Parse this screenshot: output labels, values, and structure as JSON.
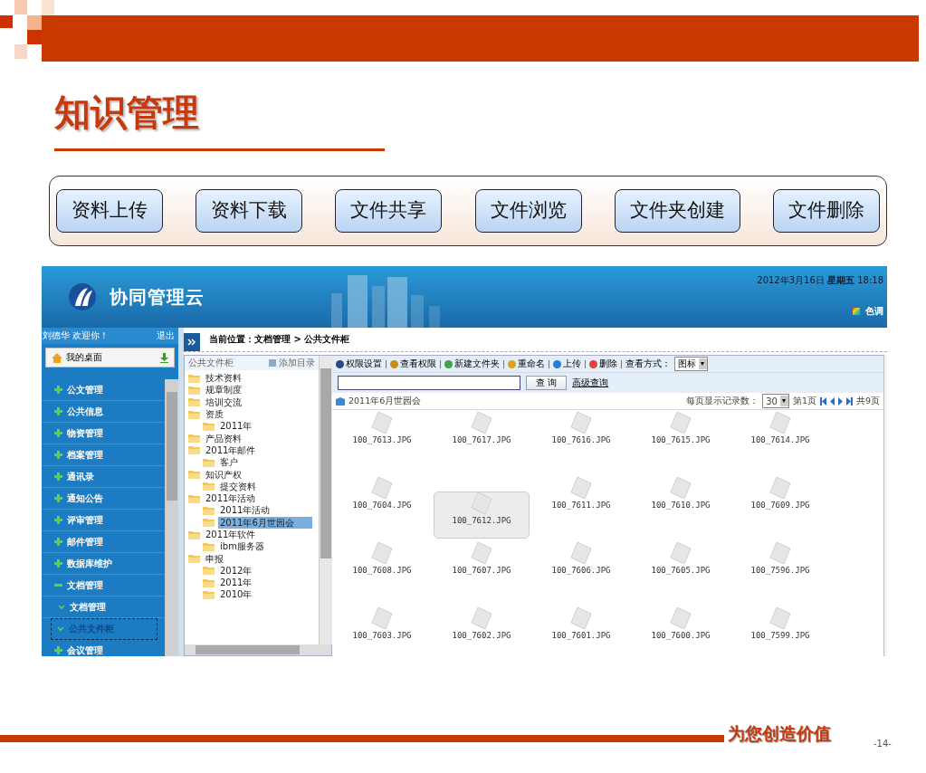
{
  "slide": {
    "title": "知识管理",
    "actions": [
      "资料上传",
      "资料下载",
      "文件共享",
      "文件浏览",
      "文件夹创建",
      "文件删除"
    ],
    "tagline": "为您创造价值",
    "page_number": "-14-"
  },
  "app": {
    "brand": "协同管理云",
    "datetime": "2012年3月16日 **星期五** 18:18",
    "theme_label": "色调",
    "user": {
      "greeting": "刘德华  欢迎你！",
      "logout": "退出"
    },
    "desktop": "我的桌面",
    "menu": [
      {
        "label": "公文管理",
        "kind": "collapsed",
        "selected": false
      },
      {
        "label": "公共信息",
        "kind": "collapsed",
        "selected": false
      },
      {
        "label": "物资管理",
        "kind": "collapsed",
        "selected": false
      },
      {
        "label": "档案管理",
        "kind": "collapsed",
        "selected": false
      },
      {
        "label": "通讯录",
        "kind": "collapsed",
        "selected": false
      },
      {
        "label": "通知公告",
        "kind": "collapsed",
        "selected": false
      },
      {
        "label": "评审管理",
        "kind": "collapsed",
        "selected": false
      },
      {
        "label": "邮件管理",
        "kind": "collapsed",
        "selected": false
      },
      {
        "label": "数据库维护",
        "kind": "collapsed",
        "selected": false
      },
      {
        "label": "文档管理",
        "kind": "expanded",
        "selected": false
      },
      {
        "label": "文档管理",
        "kind": "sub",
        "selected": false
      },
      {
        "label": "公共文件柜",
        "kind": "sub",
        "selected": true
      },
      {
        "label": "会议管理",
        "kind": "collapsed",
        "selected": false
      }
    ],
    "breadcrumb": "当前位置：文档管理 > 公共文件柜",
    "tree": {
      "title": "公共文件柜",
      "add": "添加目录",
      "nodes": [
        {
          "label": "技术资料",
          "selected": false
        },
        {
          "label": "规章制度",
          "selected": false
        },
        {
          "label": "培训交流",
          "selected": false
        },
        {
          "label": "资质",
          "selected": false,
          "children": [
            {
              "label": "2011年",
              "selected": false
            }
          ]
        },
        {
          "label": "产品资料",
          "selected": false
        },
        {
          "label": "2011年邮件",
          "selected": false,
          "children": [
            {
              "label": "客户",
              "selected": false
            }
          ]
        },
        {
          "label": "知识产权",
          "selected": false,
          "children": [
            {
              "label": "提交资料",
              "selected": false
            }
          ]
        },
        {
          "label": "2011年活动",
          "selected": false,
          "children": [
            {
              "label": "2011年活动",
              "selected": false
            },
            {
              "label": "2011年6月世园会",
              "selected": true
            }
          ]
        },
        {
          "label": "2011年软件",
          "selected": false,
          "children": [
            {
              "label": "ibm服务器",
              "selected": false
            }
          ]
        },
        {
          "label": "申报",
          "selected": false,
          "children": [
            {
              "label": "2012年",
              "selected": false
            },
            {
              "label": "2011年",
              "selected": false
            },
            {
              "label": "2010年",
              "selected": false
            }
          ]
        }
      ]
    },
    "toolbar": [
      {
        "label": "权限设置",
        "kind": "permissions"
      },
      {
        "label": "查看权限",
        "kind": "users"
      },
      {
        "label": "新建文件夹",
        "kind": "add"
      },
      {
        "label": "重命名",
        "kind": "rename"
      },
      {
        "label": "上传",
        "kind": "upload"
      },
      {
        "label": "删除",
        "kind": "delete"
      }
    ],
    "view_label": "查看方式：",
    "view_value": "图标",
    "search_button": "查 询",
    "advanced": "高级查询",
    "folder": "2011年6月世园会",
    "per_page_label": "每页显示记录数：",
    "per_page": "30",
    "page": "第1页",
    "total": "共9页",
    "files": [
      {
        "name": "100_7613.JPG",
        "selected": false
      },
      {
        "name": "100_7617.JPG",
        "selected": false
      },
      {
        "name": "100_7616.JPG",
        "selected": false
      },
      {
        "name": "100_7615.JPG",
        "selected": false
      },
      {
        "name": "100_7614.JPG",
        "selected": false
      },
      {
        "name": "100_7604.JPG",
        "selected": false
      },
      {
        "name": "100_7612.JPG",
        "selected": true
      },
      {
        "name": "100_7611.JPG",
        "selected": false
      },
      {
        "name": "100_7610.JPG",
        "selected": false
      },
      {
        "name": "100_7609.JPG",
        "selected": false
      },
      {
        "name": "100_7608.JPG",
        "selected": false
      },
      {
        "name": "100_7607.JPG",
        "selected": false
      },
      {
        "name": "100_7606.JPG",
        "selected": false
      },
      {
        "name": "100_7605.JPG",
        "selected": false
      },
      {
        "name": "100_7596.JPG",
        "selected": false
      },
      {
        "name": "100_7603.JPG",
        "selected": false
      },
      {
        "name": "100_7602.JPG",
        "selected": false
      },
      {
        "name": "100_7601.JPG",
        "selected": false
      },
      {
        "name": "100_7600.JPG",
        "selected": false
      },
      {
        "name": "100_7599.JPG",
        "selected": false
      }
    ]
  }
}
